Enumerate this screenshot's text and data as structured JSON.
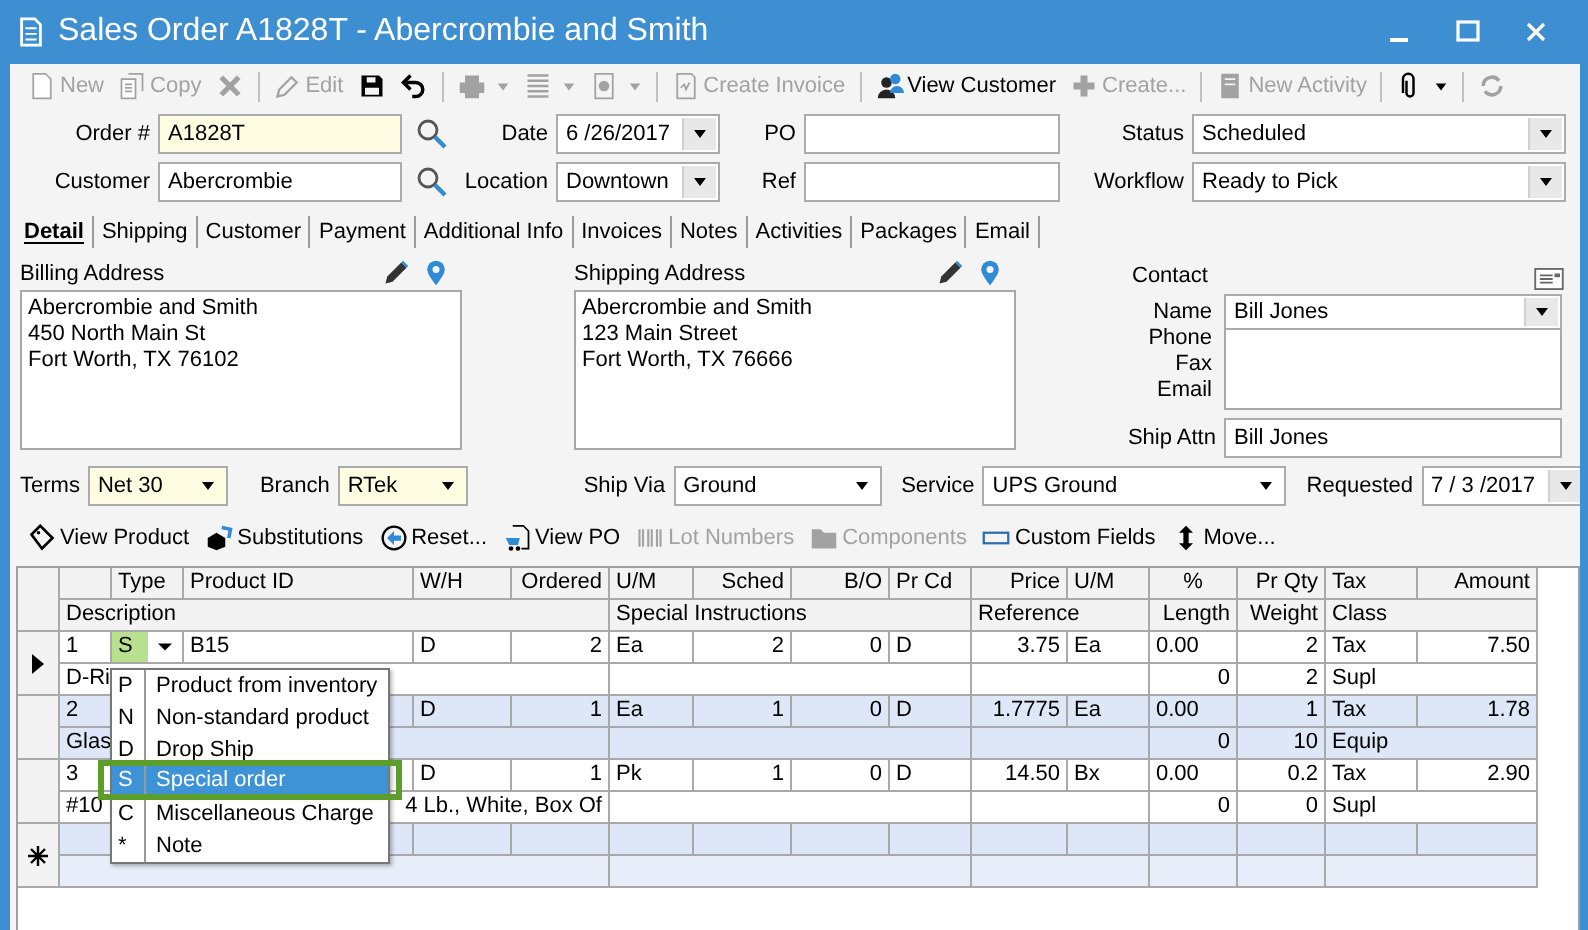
{
  "window": {
    "title": "Sales Order A1828T - Abercrombie and Smith"
  },
  "toolbar": [
    {
      "kind": "button",
      "label": "New",
      "disabled": true
    },
    {
      "kind": "button",
      "label": "Copy",
      "disabled": true
    },
    {
      "kind": "icon_button",
      "disabled": true
    },
    {
      "kind": "separator"
    },
    {
      "kind": "button",
      "label": "Edit",
      "disabled": true
    },
    {
      "kind": "icon_button",
      "disabled": false
    },
    {
      "kind": "icon_button",
      "disabled": false
    },
    {
      "kind": "separator"
    },
    {
      "kind": "menu_button",
      "disabled": true
    },
    {
      "kind": "menu_button",
      "disabled": true
    },
    {
      "kind": "menu_button",
      "disabled": true
    },
    {
      "kind": "separator"
    },
    {
      "kind": "button",
      "label": "Create Invoice",
      "disabled": true
    },
    {
      "kind": "separator"
    },
    {
      "kind": "button",
      "label": "View Customer",
      "disabled": false
    },
    {
      "kind": "button",
      "label": "Create...",
      "disabled": true
    },
    {
      "kind": "separator"
    },
    {
      "kind": "button",
      "label": "New Activity",
      "disabled": true
    },
    {
      "kind": "separator"
    },
    {
      "kind": "menu_button",
      "disabled": false
    },
    {
      "kind": "separator"
    },
    {
      "kind": "icon_button",
      "disabled": true
    }
  ],
  "order": {
    "label": "Order #",
    "value": "A1828T",
    "required": true
  },
  "date": {
    "label": "Date",
    "value": "6 /26/2017"
  },
  "po": {
    "label": "PO"
  },
  "status": {
    "label": "Status",
    "value": "Scheduled"
  },
  "customer": {
    "label": "Customer",
    "value": "Abercrombie"
  },
  "location": {
    "label": "Location",
    "value": "Downtown"
  },
  "ref": {
    "label": "Ref"
  },
  "workflow": {
    "label": "Workflow",
    "value": "Ready to Pick"
  },
  "tabs": [
    {
      "label": "Detail",
      "selected": true
    },
    {
      "label": "Shipping",
      "selected": false
    },
    {
      "label": "Customer",
      "selected": false
    },
    {
      "label": "Payment",
      "selected": false
    },
    {
      "label": "Additional Info",
      "selected": false
    },
    {
      "label": "Invoices",
      "selected": false
    },
    {
      "label": "Notes",
      "selected": false
    },
    {
      "label": "Activities",
      "selected": false
    },
    {
      "label": "Packages",
      "selected": false
    },
    {
      "label": "Email",
      "selected": false
    }
  ],
  "billing": {
    "label": "Billing Address",
    "lines": [
      "Abercrombie and Smith",
      "450 North Main St",
      "Fort Worth, TX 76102"
    ]
  },
  "shipping": {
    "label": "Shipping Address",
    "lines": [
      "Abercrombie and Smith",
      "123 Main Street",
      "Fort Worth, TX 76666"
    ]
  },
  "contact": {
    "label": "Contact",
    "name_label": "Name",
    "name": "Bill Jones",
    "phone_label": "Phone",
    "fax_label": "Fax",
    "email_label": "Email",
    "ship_attn_label": "Ship Attn",
    "ship_attn": "Bill Jones"
  },
  "terms": {
    "label": "Terms",
    "value": "Net 30",
    "required": true
  },
  "branch": {
    "label": "Branch",
    "value": "RTek",
    "required": true
  },
  "ship_via": {
    "label": "Ship Via",
    "value": "Ground"
  },
  "service": {
    "label": "Service",
    "value": "UPS Ground"
  },
  "requested": {
    "label": "Requested",
    "value": "7 / 3 /2017"
  },
  "grid_toolbar": [
    {
      "label": "View Product",
      "disabled": false
    },
    {
      "label": "Substitutions",
      "disabled": false
    },
    {
      "label": "Reset...",
      "disabled": false
    },
    {
      "label": "View PO",
      "disabled": false
    },
    {
      "label": "Lot Numbers",
      "disabled": true
    },
    {
      "label": "Components",
      "disabled": true
    },
    {
      "label": "Custom Fields",
      "disabled": false
    },
    {
      "label": "Move...",
      "disabled": false
    }
  ],
  "grid": {
    "columns": [
      "",
      "Type",
      "Product ID",
      "W/H",
      "Ordered",
      "U/M",
      "Sched",
      "B/O",
      "Pr Cd",
      "Price",
      "U/M",
      "%",
      "Pr Qty",
      "Tax",
      "Amount"
    ],
    "subcolumns": [
      "Description",
      "Special Instructions",
      "Reference",
      "Length",
      "Weight",
      "Class"
    ],
    "rows": [
      {
        "current": true,
        "editing": true,
        "cells": [
          "1",
          "S",
          "B15",
          "D",
          "2",
          "Ea",
          "2",
          "0",
          "D",
          "3.75",
          "Ea",
          "0.00",
          "2",
          "Tax",
          "7.50"
        ],
        "sub_cells": [
          "D-Ri",
          null,
          null,
          "0",
          "2",
          "Supl"
        ]
      },
      {
        "current": false,
        "cells": [
          "2",
          null,
          null,
          "D",
          "1",
          "Ea",
          "1",
          "0",
          "D",
          "1.7775",
          "Ea",
          "0.00",
          "1",
          "Tax",
          "1.78"
        ],
        "sub_cells": [
          "Glas",
          null,
          null,
          "0",
          "10",
          "Equip"
        ]
      },
      {
        "current": false,
        "cells": [
          "3",
          null,
          null,
          "D",
          "1",
          "Pk",
          "1",
          "0",
          "D",
          "14.50",
          "Bx",
          "0.00",
          "0.2",
          "Tax",
          "2.90"
        ],
        "sub_cells": [
          "#10",
          null,
          null,
          "0",
          "0",
          "Supl"
        ],
        "description_tail": "4 Lb., White, Box Of"
      }
    ],
    "type_menu": [
      {
        "code": "P",
        "label": "Product from inventory",
        "selected": false,
        "annotated": false
      },
      {
        "code": "N",
        "label": "Non-standard product",
        "selected": false,
        "annotated": false
      },
      {
        "code": "D",
        "label": "Drop Ship",
        "selected": false,
        "annotated": false
      },
      {
        "code": "S",
        "label": "Special order",
        "selected": true,
        "annotated": true
      },
      {
        "code": "C",
        "label": "Miscellaneous Charge",
        "selected": false,
        "annotated": false
      },
      {
        "code": "*",
        "label": "Note",
        "selected": false,
        "annotated": false
      }
    ]
  }
}
